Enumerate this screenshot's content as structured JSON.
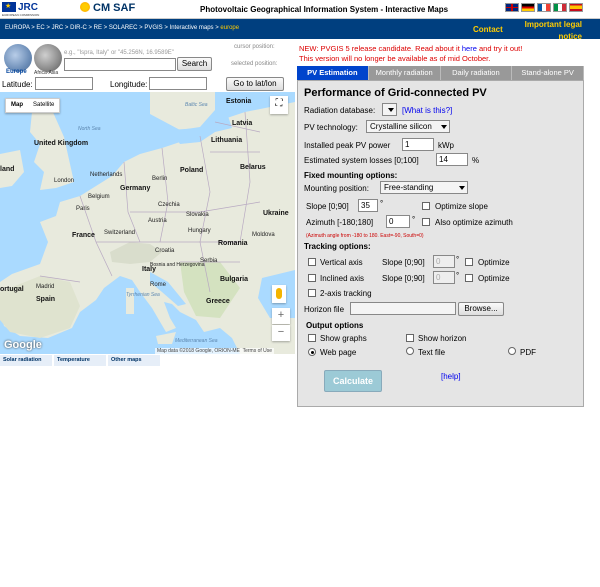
{
  "header": {
    "jrc_logo_text": "JRC",
    "jrc_logo_sub": "EUROPEAN COMMISSION",
    "cmsaf_logo_text": "CM SAF",
    "app_title": "Photovoltaic Geographical Information System - Interactive Maps",
    "language_flags": [
      "English",
      "Deutsch",
      "Français",
      "Italiano",
      "Español"
    ]
  },
  "navbar": {
    "breadcrumb": [
      "EUROPA",
      "EC",
      "JRC",
      "DIR-C",
      "RE",
      "SOLAREC",
      "PVGIS",
      "Interactive maps"
    ],
    "breadcrumb_current": "europe",
    "contact": "Contact",
    "legal": "Important legal notice"
  },
  "left": {
    "globe_europe_label": "Europe",
    "globe_africa_label": "Africa-Asia",
    "search_hint": "e.g., \"Ispra, Italy\" or \"45.256N, 16.9589E\"",
    "search_value": "",
    "search_button": "Search",
    "cursor_position_label": "cursor position:",
    "selected_position_label": "selected position:",
    "latitude_label": "Latitude:",
    "latitude_value": "",
    "longitude_label": "Longitude:",
    "longitude_value": "",
    "goto_button": "Go to lat/lon"
  },
  "map": {
    "map_button": "Map",
    "satellite_button": "Satellite",
    "google_logo": "Google",
    "attribution": "Map data ©2018 Google, ORION-ME",
    "terms": "Terms of Use",
    "labels": {
      "estonia": "Estonia",
      "baltic_sea": "Baltic Sea",
      "north_sea": "North Sea",
      "latvia": "Latvia",
      "lithuania": "Lithuania",
      "united_kingdom": "United Kingdom",
      "ireland": "land",
      "belarus": "Belarus",
      "netherlands": "Netherlands",
      "berlin": "Berlin",
      "poland": "Poland",
      "london": "London",
      "germany": "Germany",
      "belgium": "Belgium",
      "paris": "Paris",
      "czechia": "Czechia",
      "slovakia": "Slovakia",
      "ukraine": "Ukraine",
      "france": "France",
      "austria": "Austria",
      "hungary": "Hungary",
      "switzerland": "Switzerland",
      "moldova": "Moldova",
      "croatia": "Croatia",
      "romania": "Romania",
      "bosnia": "Bosnia and Herzegovina",
      "serbia": "Serbia",
      "bulgaria": "Bulgaria",
      "italy": "Italy",
      "rome": "Rome",
      "portugal": "ortugal",
      "spain": "Spain",
      "madrid": "Madrid",
      "greece": "Greece",
      "tyrrhenian_sea": "Tyrrhenian Sea",
      "mediterranean_sea": "Mediterranean Sea"
    }
  },
  "bottom_tabs": [
    "Solar radiation",
    "Temperature",
    "Other maps"
  ],
  "news": {
    "line1_before": "NEW: PVGIS 5 release candidate. Read about it ",
    "line1_link": "here",
    "line1_after": " and try it out!",
    "line2": "This version will no longer be available as of mid October."
  },
  "tabs": [
    "PV Estimation",
    "Monthly radiation",
    "Daily radiation",
    "Stand-alone PV"
  ],
  "form": {
    "title": "Performance of Grid-connected PV",
    "radiation_db_label": "Radiation database:",
    "radiation_db_value": "",
    "what_is_this": "[What is this?]",
    "pv_tech_label": "PV technology:",
    "pv_tech_value": "Crystalline silicon",
    "peak_power_label": "Installed peak PV power",
    "peak_power_value": "1",
    "peak_power_unit": "kWp",
    "losses_label": "Estimated system losses [0;100]",
    "losses_value": "14",
    "losses_unit": "%",
    "fixed_heading": "Fixed mounting options:",
    "mounting_label": "Mounting position:",
    "mounting_value": "Free-standing",
    "slope_label": "Slope [0;90]",
    "slope_value": "35",
    "degree": "°",
    "optimize_slope": "Optimize slope",
    "azimuth_label": "Azimuth [-180;180]",
    "azimuth_value": "0",
    "optimize_azimuth": "Also optimize azimuth",
    "azimuth_note": "(Azimuth angle from -180 to 180. East=-90, South=0)",
    "tracking_heading": "Tracking options:",
    "vertical_axis": "Vertical axis",
    "inclined_axis": "Inclined axis",
    "two_axis": "2-axis tracking",
    "tracking_slope_label": "Slope [0;90]",
    "tracking_slope_value": "0",
    "optimize": "Optimize",
    "horizon_label": "Horizon file",
    "browse": "Browse...",
    "output_heading": "Output options",
    "show_graphs": "Show graphs",
    "show_horizon": "Show horizon",
    "web_page": "Web page",
    "text_file": "Text file",
    "pdf": "PDF",
    "calculate": "Calculate",
    "help": "[help]"
  }
}
